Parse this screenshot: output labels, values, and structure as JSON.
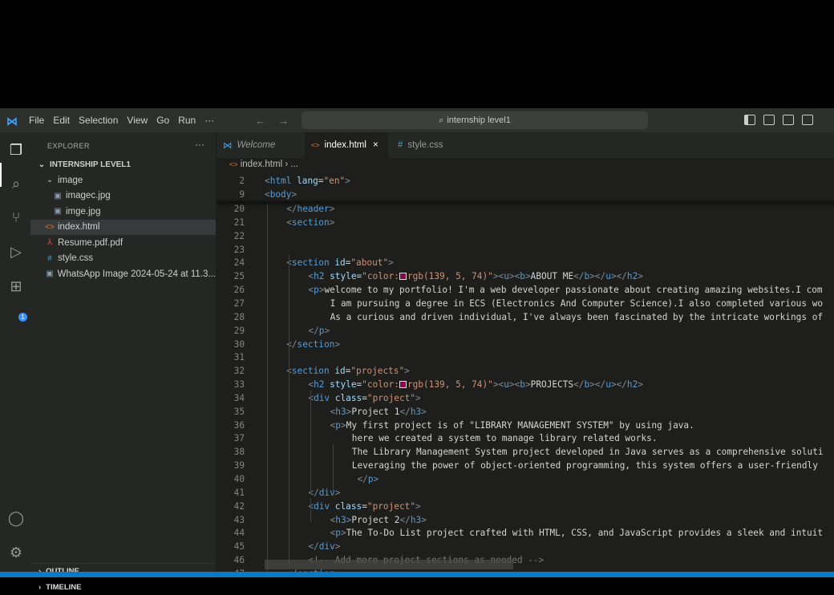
{
  "titlebar": {
    "menu": [
      "File",
      "Edit",
      "Selection",
      "View",
      "Go",
      "Run",
      "···"
    ],
    "search": "internship level1"
  },
  "sidebar": {
    "title": "EXPLORER",
    "more": "···",
    "root": "INTERNSHIP LEVEL1",
    "items": [
      {
        "label": "image",
        "icon": "chevron-down",
        "depth": 1
      },
      {
        "label": "imagec.jpg",
        "icon": "image",
        "depth": 2
      },
      {
        "label": "imge.jpg",
        "icon": "image",
        "depth": 2
      },
      {
        "label": "index.html",
        "icon": "html",
        "depth": 1,
        "selected": true
      },
      {
        "label": "Resume.pdf.pdf",
        "icon": "pdf",
        "depth": 1
      },
      {
        "label": "style.css",
        "icon": "css",
        "depth": 1
      },
      {
        "label": "WhatsApp Image 2024-05-24 at 11.3...",
        "icon": "image",
        "depth": 1
      }
    ],
    "outline": "OUTLINE",
    "timeline": "TIMELINE"
  },
  "activity": {
    "extensions_badge": "1"
  },
  "tabs": [
    {
      "label": "Welcome",
      "icon": "vscode"
    },
    {
      "label": "index.html",
      "icon": "html",
      "active": true,
      "close": "×"
    },
    {
      "label": "style.css",
      "icon": "css"
    }
  ],
  "breadcrumb": {
    "file": "index.html",
    "sep": "›",
    "rest": "..."
  },
  "sticky": [
    {
      "n": "2",
      "i": 0,
      "s": [
        [
          "tag",
          "<"
        ],
        [
          "name",
          "html"
        ],
        [
          "attr",
          " lang"
        ],
        [
          "punc",
          "="
        ],
        [
          "str",
          "\"en\""
        ],
        [
          "tag",
          ">"
        ]
      ]
    },
    {
      "n": "9",
      "i": 0,
      "s": [
        [
          "tag",
          "<"
        ],
        [
          "name",
          "body"
        ],
        [
          "tag",
          ">"
        ]
      ]
    }
  ],
  "lines": [
    {
      "n": "20",
      "i": 1,
      "s": [
        [
          "tag",
          "</"
        ],
        [
          "name",
          "header"
        ],
        [
          "tag",
          ">"
        ]
      ]
    },
    {
      "n": "21",
      "i": 1,
      "s": [
        [
          "tag",
          "<"
        ],
        [
          "name",
          "section"
        ],
        [
          "tag",
          ">"
        ]
      ]
    },
    {
      "n": "22",
      "i": 0,
      "s": []
    },
    {
      "n": "23",
      "i": 0,
      "s": []
    },
    {
      "n": "24",
      "i": 1,
      "s": [
        [
          "tag",
          "<"
        ],
        [
          "name",
          "section"
        ],
        [
          "attr",
          " id"
        ],
        [
          "punc",
          "="
        ],
        [
          "str",
          "\"about\""
        ],
        [
          "tag",
          ">"
        ]
      ]
    },
    {
      "n": "25",
      "i": 2,
      "s": [
        [
          "tag",
          "<"
        ],
        [
          "name",
          "h2"
        ],
        [
          "attr",
          " style"
        ],
        [
          "punc",
          "="
        ],
        [
          "str",
          "\"color:"
        ],
        [
          "swatch",
          ""
        ],
        [
          "str",
          "rgb(139, 5, 74)\""
        ],
        [
          "tag",
          ">"
        ],
        [
          "tag",
          "<"
        ],
        [
          "name",
          "u"
        ],
        [
          "tag",
          ">"
        ],
        [
          "tag",
          "<"
        ],
        [
          "name",
          "b"
        ],
        [
          "tag",
          ">"
        ],
        [
          "txt",
          "ABOUT ME"
        ],
        [
          "tag",
          "</"
        ],
        [
          "name",
          "b"
        ],
        [
          "tag",
          ">"
        ],
        [
          "tag",
          "</"
        ],
        [
          "name",
          "u"
        ],
        [
          "tag",
          ">"
        ],
        [
          "tag",
          "</"
        ],
        [
          "name",
          "h2"
        ],
        [
          "tag",
          ">"
        ]
      ]
    },
    {
      "n": "26",
      "i": 2,
      "s": [
        [
          "tag",
          "<"
        ],
        [
          "name",
          "p"
        ],
        [
          "tag",
          ">"
        ],
        [
          "txt",
          "welcome to my portfolio! I'm a web developer passionate about creating amazing websites.I com"
        ]
      ]
    },
    {
      "n": "27",
      "i": 3,
      "s": [
        [
          "txt",
          "I am pursuing a degree in ECS (Electronics And Computer Science).I also completed various wo"
        ]
      ]
    },
    {
      "n": "28",
      "i": 3,
      "s": [
        [
          "txt",
          "As a curious and driven individual, I've always been fascinated by the intricate workings of"
        ]
      ]
    },
    {
      "n": "29",
      "i": 2,
      "s": [
        [
          "tag",
          "</"
        ],
        [
          "name",
          "p"
        ],
        [
          "tag",
          ">"
        ]
      ]
    },
    {
      "n": "30",
      "i": 1,
      "s": [
        [
          "tag",
          "</"
        ],
        [
          "name",
          "section"
        ],
        [
          "tag",
          ">"
        ]
      ]
    },
    {
      "n": "31",
      "i": 0,
      "s": []
    },
    {
      "n": "32",
      "i": 1,
      "s": [
        [
          "tag",
          "<"
        ],
        [
          "name",
          "section"
        ],
        [
          "attr",
          " id"
        ],
        [
          "punc",
          "="
        ],
        [
          "str",
          "\"projects\""
        ],
        [
          "tag",
          ">"
        ]
      ]
    },
    {
      "n": "33",
      "i": 2,
      "s": [
        [
          "tag",
          "<"
        ],
        [
          "name",
          "h2"
        ],
        [
          "attr",
          " style"
        ],
        [
          "punc",
          "="
        ],
        [
          "str",
          "\"color:"
        ],
        [
          "swatch",
          ""
        ],
        [
          "str",
          "rgb(139, 5, 74)\""
        ],
        [
          "tag",
          ">"
        ],
        [
          "tag",
          "<"
        ],
        [
          "name",
          "u"
        ],
        [
          "tag",
          ">"
        ],
        [
          "tag",
          "<"
        ],
        [
          "name",
          "b"
        ],
        [
          "tag",
          ">"
        ],
        [
          "txt",
          "PROJECTS"
        ],
        [
          "tag",
          "</"
        ],
        [
          "name",
          "b"
        ],
        [
          "tag",
          ">"
        ],
        [
          "tag",
          "</"
        ],
        [
          "name",
          "u"
        ],
        [
          "tag",
          ">"
        ],
        [
          "tag",
          "</"
        ],
        [
          "name",
          "h2"
        ],
        [
          "tag",
          ">"
        ]
      ]
    },
    {
      "n": "34",
      "i": 2,
      "s": [
        [
          "tag",
          "<"
        ],
        [
          "name",
          "div"
        ],
        [
          "attr",
          " class"
        ],
        [
          "punc",
          "="
        ],
        [
          "str",
          "\"project\""
        ],
        [
          "tag",
          ">"
        ]
      ]
    },
    {
      "n": "35",
      "i": 3,
      "s": [
        [
          "tag",
          "<"
        ],
        [
          "name",
          "h3"
        ],
        [
          "tag",
          ">"
        ],
        [
          "txt",
          "Project 1"
        ],
        [
          "tag",
          "</"
        ],
        [
          "name",
          "h3"
        ],
        [
          "tag",
          ">"
        ]
      ]
    },
    {
      "n": "36",
      "i": 3,
      "s": [
        [
          "tag",
          "<"
        ],
        [
          "name",
          "p"
        ],
        [
          "tag",
          ">"
        ],
        [
          "txt",
          "My first project is of \"LIBRARY MANAGEMENT SYSTEM\" by using java."
        ]
      ]
    },
    {
      "n": "37",
      "i": 4,
      "s": [
        [
          "txt",
          "here we created a system to manage library related works."
        ]
      ]
    },
    {
      "n": "38",
      "i": 4,
      "s": [
        [
          "txt",
          "The Library Management System project developed in Java serves as a comprehensive soluti"
        ]
      ]
    },
    {
      "n": "39",
      "i": 4,
      "s": [
        [
          "txt",
          "Leveraging the power of object-oriented programming, this system offers a user-friendly"
        ]
      ]
    },
    {
      "n": "40",
      "i": 4,
      "s": [
        [
          "tag",
          " </"
        ],
        [
          "name",
          "p"
        ],
        [
          "tag",
          ">"
        ]
      ]
    },
    {
      "n": "41",
      "i": 2,
      "s": [
        [
          "tag",
          "</"
        ],
        [
          "name",
          "div"
        ],
        [
          "tag",
          ">"
        ]
      ]
    },
    {
      "n": "42",
      "i": 2,
      "s": [
        [
          "tag",
          "<"
        ],
        [
          "name",
          "div"
        ],
        [
          "attr",
          " class"
        ],
        [
          "punc",
          "="
        ],
        [
          "str",
          "\"project\""
        ],
        [
          "tag",
          ">"
        ]
      ]
    },
    {
      "n": "43",
      "i": 3,
      "s": [
        [
          "tag",
          "<"
        ],
        [
          "name",
          "h3"
        ],
        [
          "tag",
          ">"
        ],
        [
          "txt",
          "Project 2"
        ],
        [
          "tag",
          "</"
        ],
        [
          "name",
          "h3"
        ],
        [
          "tag",
          ">"
        ]
      ]
    },
    {
      "n": "44",
      "i": 3,
      "s": [
        [
          "tag",
          "<"
        ],
        [
          "name",
          "p"
        ],
        [
          "tag",
          ">"
        ],
        [
          "txt",
          "The To-Do List project crafted with HTML, CSS, and JavaScript provides a sleek and intuit"
        ]
      ]
    },
    {
      "n": "45",
      "i": 2,
      "s": [
        [
          "tag",
          "</"
        ],
        [
          "name",
          "div"
        ],
        [
          "tag",
          ">"
        ]
      ]
    },
    {
      "n": "46",
      "i": 2,
      "s": [
        [
          "com",
          "<!-- Add more project sections as needed -->"
        ]
      ]
    },
    {
      "n": "47",
      "i": 1,
      "s": [
        [
          "tag",
          "</"
        ],
        [
          "name",
          "section"
        ],
        [
          "tag",
          ">"
        ]
      ]
    }
  ]
}
